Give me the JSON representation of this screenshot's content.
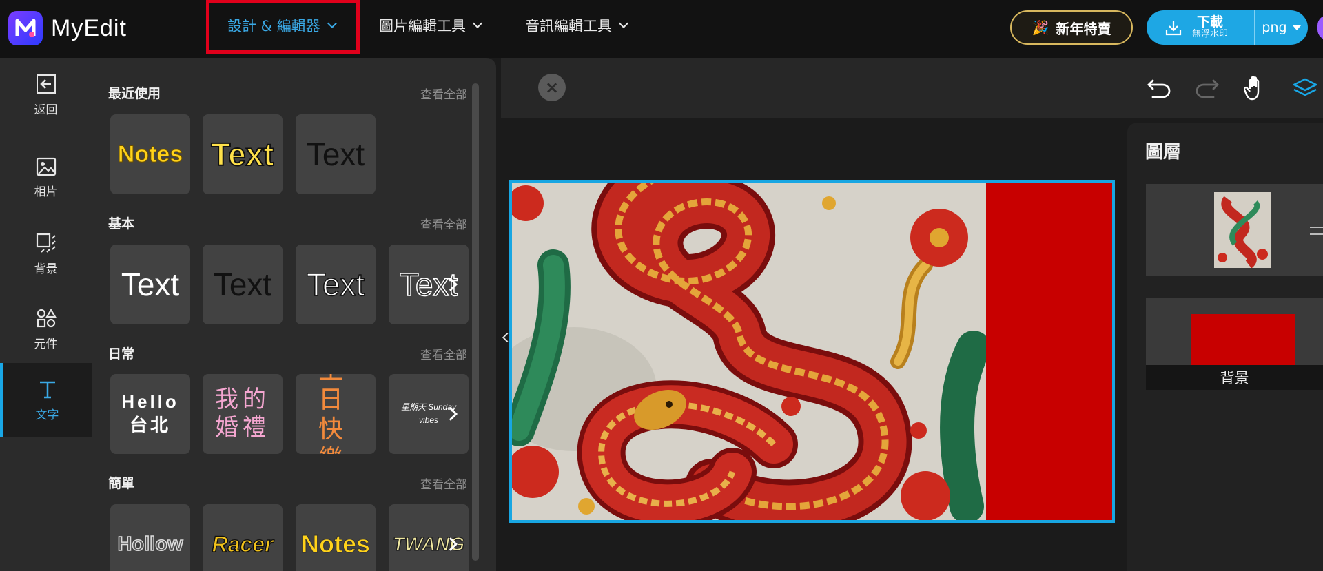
{
  "app": {
    "name": "MyEdit"
  },
  "nav": {
    "design_label": "設計 & 編輯器",
    "image_tools_label": "圖片編輯工具",
    "audio_tools_label": "音訊編輯工具"
  },
  "promo": {
    "label": "新年特賣",
    "icon": "party-popper-icon"
  },
  "download": {
    "title": "下載",
    "subtitle": "無浮水印",
    "format": "png"
  },
  "rail": {
    "items": [
      {
        "label": "返回",
        "icon": "arrow-left-icon"
      },
      {
        "label": "相片",
        "icon": "image-icon"
      },
      {
        "label": "背景",
        "icon": "background-icon"
      },
      {
        "label": "元件",
        "icon": "shapes-icon"
      },
      {
        "label": "文字",
        "icon": "text-icon",
        "active": true
      }
    ]
  },
  "panel": {
    "view_all": "查看全部",
    "sections": [
      {
        "title": "最近使用",
        "tiles": [
          "Notes",
          "Text",
          "Text"
        ]
      },
      {
        "title": "基本",
        "tiles": [
          "Text",
          "Text",
          "Text",
          "Text"
        ]
      },
      {
        "title": "日常",
        "tiles": [
          "Hello 台北",
          "我的婚禮",
          "生日快樂",
          "星期天 Sunday vibes"
        ]
      },
      {
        "title": "簡單",
        "tiles": [
          "Hollow",
          "Racer",
          "Notes",
          "TWANG"
        ]
      }
    ]
  },
  "toolbar": {
    "icons": [
      "close-icon",
      "undo-icon",
      "redo-icon",
      "hand-icon",
      "layers-icon"
    ]
  },
  "layers": {
    "title": "圖層",
    "background_label": "背景"
  },
  "colors": {
    "accent": "#19a7e6",
    "highlight": "#e0001b",
    "red_block": "#c80000"
  }
}
